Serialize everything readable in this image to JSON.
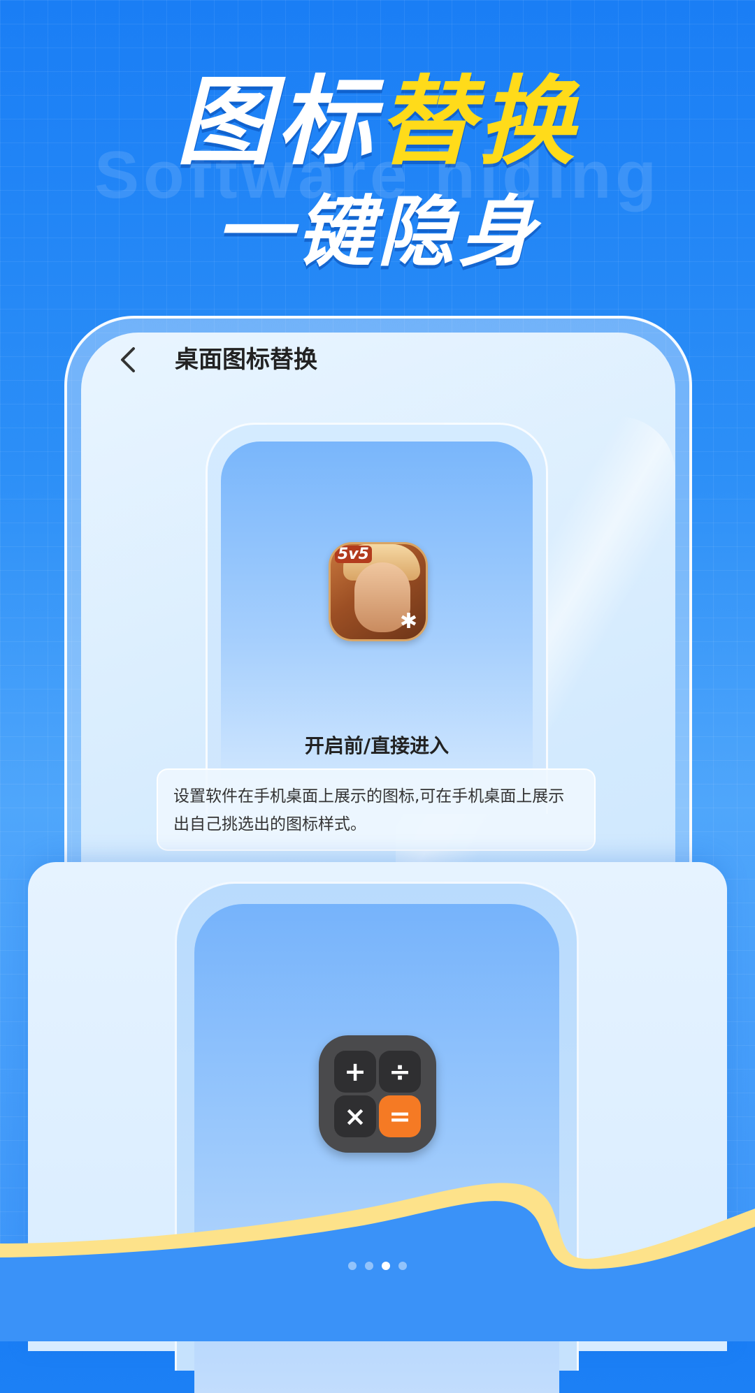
{
  "headline": {
    "line1_white": "图标",
    "line1_yellow": "替换",
    "watermark": "Software hiding",
    "line2": "一键隐身"
  },
  "screen": {
    "title": "桌面图标替换",
    "back_icon": "chevron-left-icon",
    "before_label": "开启前/直接进入",
    "description": "设置软件在手机桌面上展示的图标,可在手机桌面上展示出自己挑选出的图标样式。",
    "game_icon": {
      "badge": "5v5",
      "name": "game-app-icon"
    },
    "calculator_icon": {
      "keys": [
        "+",
        "÷",
        "×",
        "="
      ]
    }
  },
  "pagination": {
    "total": 4,
    "active": 3
  },
  "colors": {
    "background": "#2c8ff7",
    "accent_yellow": "#ffdb1a",
    "wave_yellow": "#fde28a",
    "calc_orange": "#f57a24"
  }
}
